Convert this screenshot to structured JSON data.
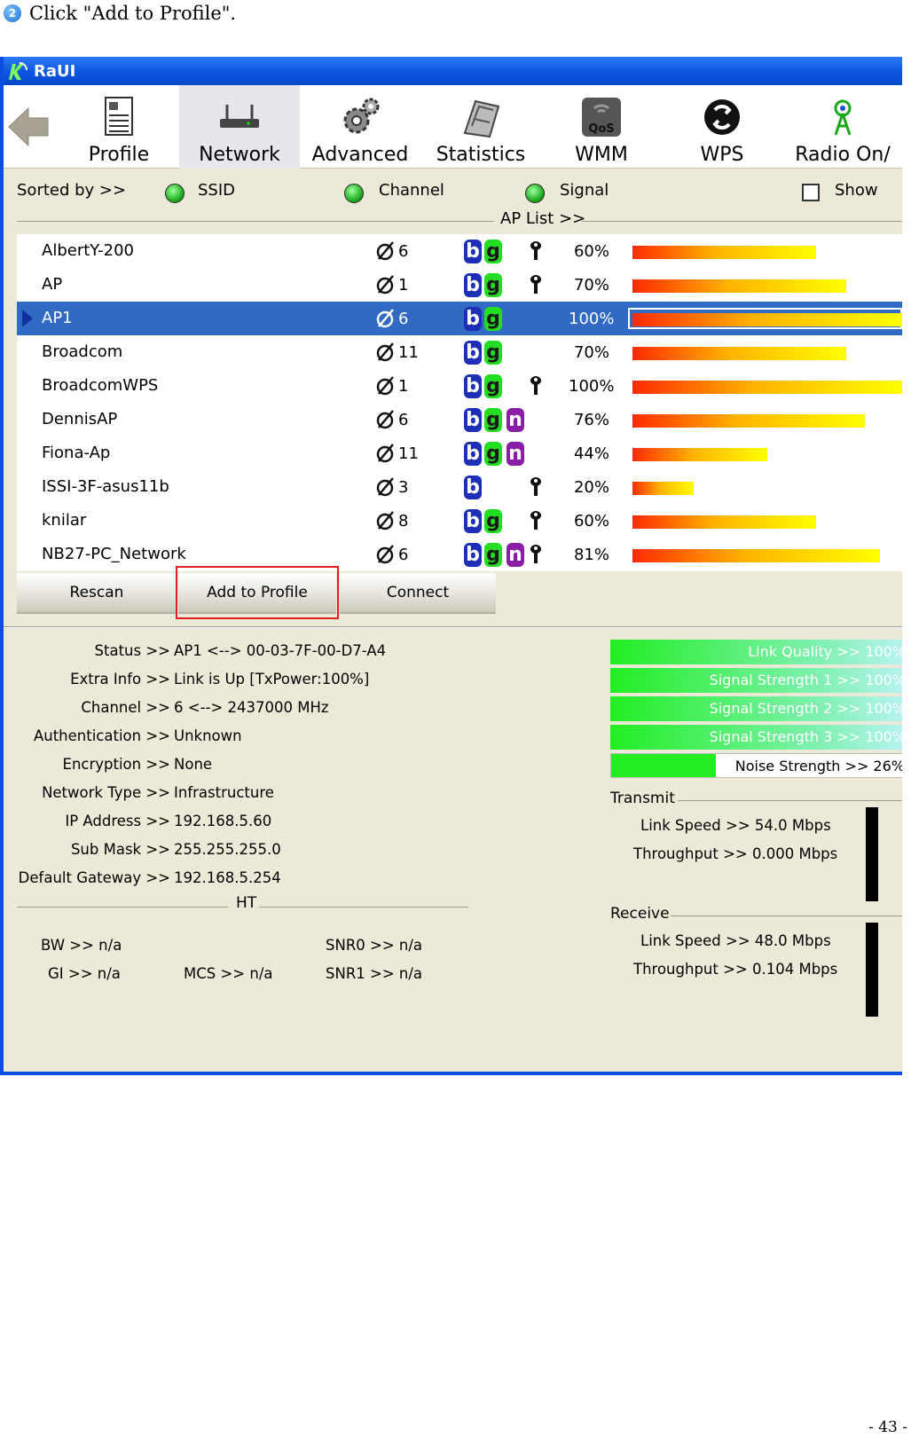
{
  "step": {
    "number": "2",
    "text": "Click \"Add to Profile\"."
  },
  "window": {
    "title": "RaUI"
  },
  "toolbar": {
    "back": "back-arrow",
    "buttons": [
      {
        "label": "Profile",
        "icon": "profile-icon"
      },
      {
        "label": "Network",
        "icon": "network-icon"
      },
      {
        "label": "Advanced",
        "icon": "advanced-gear-icon"
      },
      {
        "label": "Statistics",
        "icon": "statistics-icon"
      },
      {
        "label": "WMM",
        "icon": "wmm-qos-icon"
      },
      {
        "label": "WPS",
        "icon": "wps-icon"
      },
      {
        "label": "Radio On/",
        "icon": "radio-antenna-icon"
      }
    ]
  },
  "sort": {
    "label": "Sorted by >>",
    "ssid": "SSID",
    "channel": "Channel",
    "signal": "Signal",
    "show": "Show"
  },
  "ap_list_title": "AP List >>",
  "ap_list": [
    {
      "ssid": "AlbertY-200",
      "channel": "6",
      "b": "b",
      "g": "g",
      "n": "",
      "secure": true,
      "signal": "60%",
      "signal_pct": 60
    },
    {
      "ssid": "AP",
      "channel": "1",
      "b": "b",
      "g": "g",
      "n": "",
      "secure": true,
      "signal": "70%",
      "signal_pct": 70
    },
    {
      "ssid": "AP1",
      "channel": "6",
      "b": "b",
      "g": "g",
      "n": "",
      "secure": false,
      "signal": "100%",
      "signal_pct": 100,
      "selected": true
    },
    {
      "ssid": "Broadcom",
      "channel": "11",
      "b": "b",
      "g": "g",
      "n": "",
      "secure": false,
      "signal": "70%",
      "signal_pct": 70
    },
    {
      "ssid": "BroadcomWPS",
      "channel": "1",
      "b": "b",
      "g": "g",
      "n": "",
      "secure": true,
      "signal": "100%",
      "signal_pct": 100
    },
    {
      "ssid": "DennisAP",
      "channel": "6",
      "b": "b",
      "g": "g",
      "n": "n",
      "secure": false,
      "signal": "76%",
      "signal_pct": 76
    },
    {
      "ssid": "Fiona-Ap",
      "channel": "11",
      "b": "b",
      "g": "g",
      "n": "n",
      "secure": false,
      "signal": "44%",
      "signal_pct": 44
    },
    {
      "ssid": "ISSI-3F-asus11b",
      "channel": "3",
      "b": "b",
      "g": "",
      "n": "",
      "secure": true,
      "signal": "20%",
      "signal_pct": 20
    },
    {
      "ssid": "knilar",
      "channel": "8",
      "b": "b",
      "g": "g",
      "n": "",
      "secure": true,
      "signal": "60%",
      "signal_pct": 60
    },
    {
      "ssid": "NB27-PC_Network",
      "channel": "6",
      "b": "b",
      "g": "g",
      "n": "n",
      "secure": true,
      "signal": "81%",
      "signal_pct": 81
    }
  ],
  "buttons": {
    "rescan": "Rescan",
    "add_to_profile": "Add to Profile",
    "connect": "Connect"
  },
  "status": {
    "status_k": "Status >>",
    "status_v": "AP1 <--> 00-03-7F-00-D7-A4",
    "extra_k": "Extra Info >>",
    "extra_v": "Link is Up [TxPower:100%]",
    "channel_k": "Channel >>",
    "channel_v": "6 <--> 2437000 MHz",
    "auth_k": "Authentication >>",
    "auth_v": "Unknown",
    "enc_k": "Encryption >>",
    "enc_v": "None",
    "nettype_k": "Network Type >>",
    "nettype_v": "Infrastructure",
    "ip_k": "IP Address >>",
    "ip_v": "192.168.5.60",
    "mask_k": "Sub Mask >>",
    "mask_v": "255.255.255.0",
    "gw_k": "Default Gateway >>",
    "gw_v": "192.168.5.254"
  },
  "ht": {
    "title": "HT",
    "bw": "BW >> n/a",
    "gi": "GI >> n/a",
    "mcs": "MCS >> n/a",
    "snr0": "SNR0 >> n/a",
    "snr1": "SNR1 >> n/a"
  },
  "quality": {
    "link_quality": "Link Quality >> 100%",
    "signal1": "Signal Strength 1 >> 100%",
    "signal2": "Signal Strength 2 >> 100%",
    "signal3": "Signal Strength 3 >> 100%",
    "noise": "Noise Strength >> 26%"
  },
  "transmit": {
    "title": "Transmit",
    "link_speed": "Link Speed >> 54.0 Mbps",
    "throughput": "Throughput >> 0.000 Mbps"
  },
  "receive": {
    "title": "Receive",
    "link_speed": "Link Speed >> 48.0 Mbps",
    "throughput": "Throughput >> 0.104 Mbps"
  },
  "page_number": "- 43 -",
  "colors": {
    "title_bar": "#0a53e0",
    "selected_row": "#316ac5",
    "highlight": "#e02020",
    "quality_bar": "#22ee22"
  }
}
